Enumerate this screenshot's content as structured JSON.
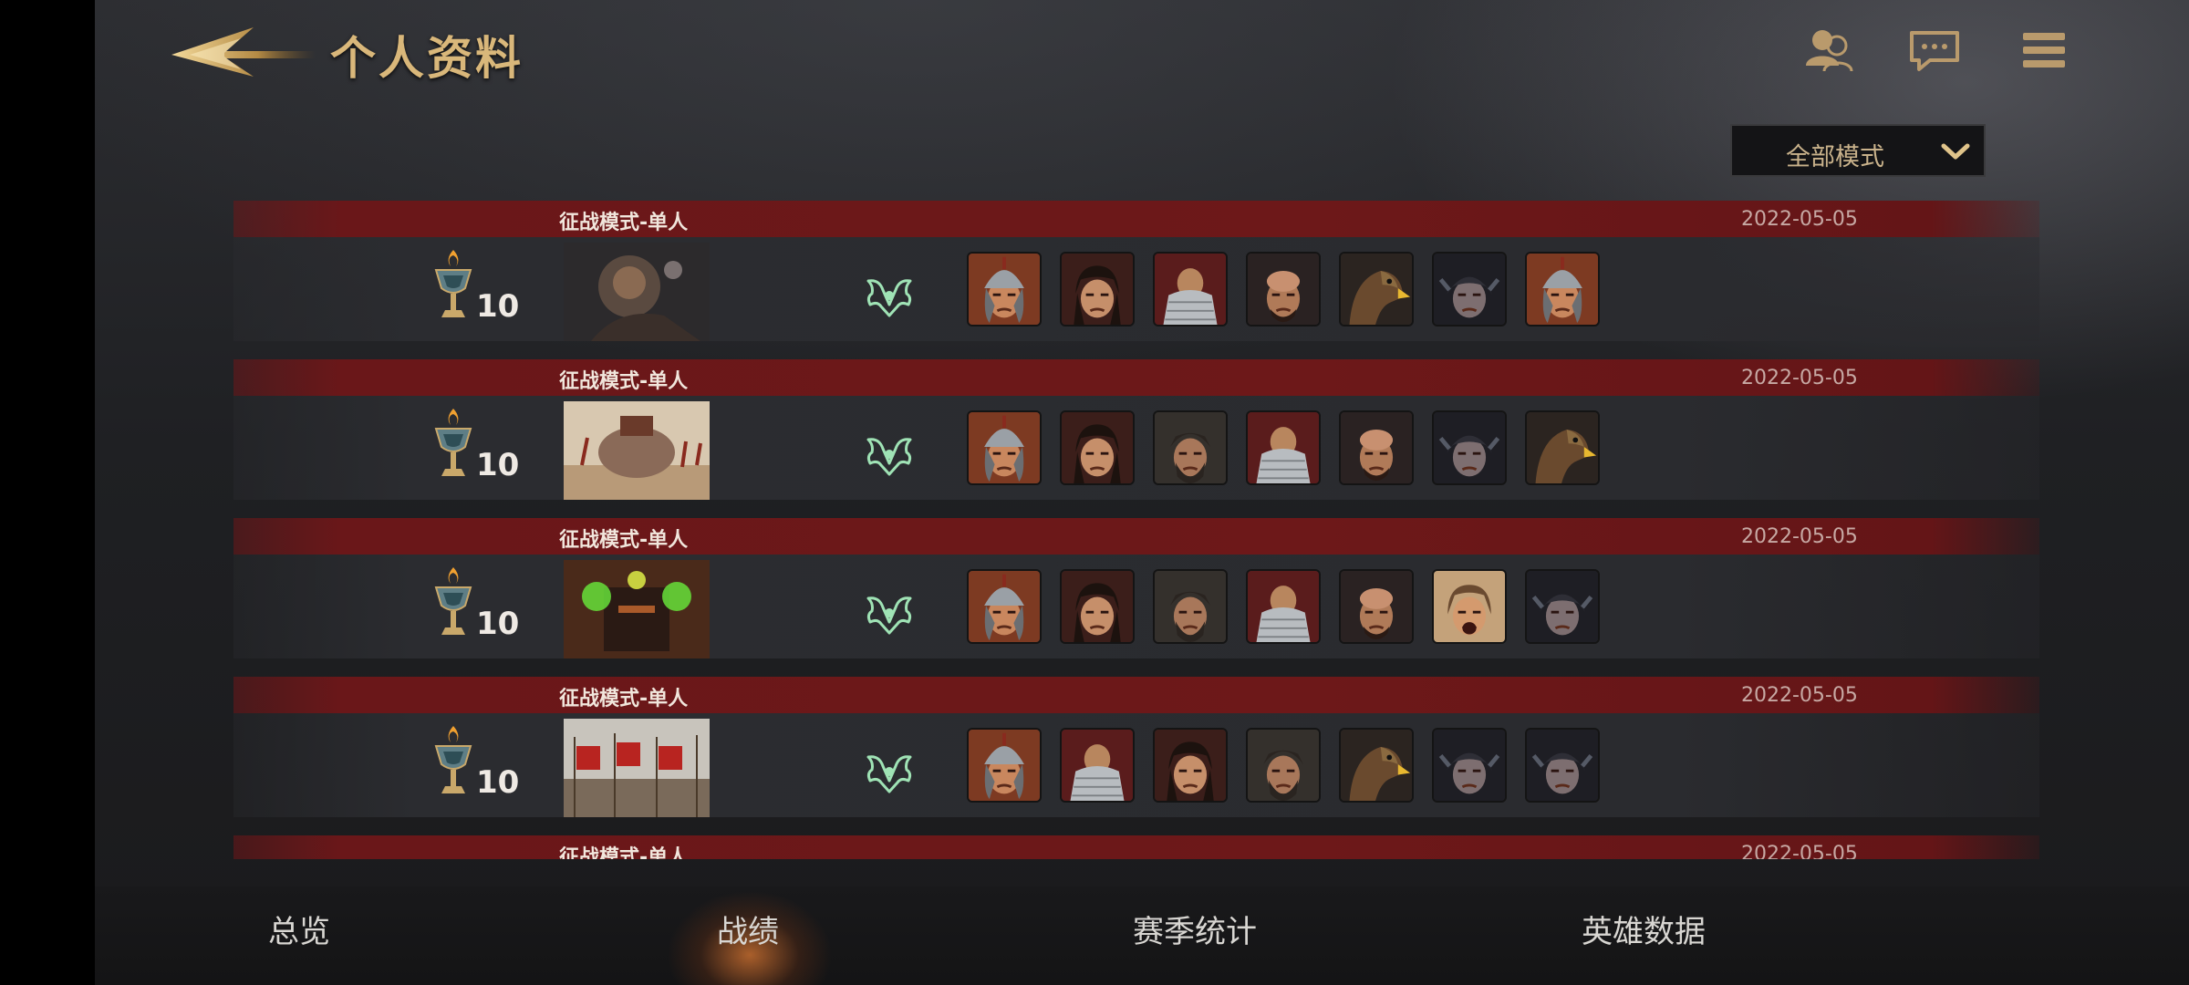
{
  "header": {
    "title": "个人资料"
  },
  "filter": {
    "selected": "全部模式"
  },
  "records": [
    {
      "mode": "征战模式-单人",
      "date": "2022-05-05",
      "score": "10",
      "map": "beast-warrior",
      "heroes": [
        "helmet-warrior",
        "dark-hair",
        "armored-bald",
        "bald-warrior",
        "eagle",
        "dark-helmet",
        "helmet-warrior"
      ]
    },
    {
      "mode": "征战模式-单人",
      "date": "2022-05-05",
      "score": "10",
      "map": "elephant-battle",
      "heroes": [
        "helmet-warrior",
        "dark-hair",
        "bearded",
        "armored-bald",
        "bald-warrior",
        "dark-helmet",
        "eagle"
      ]
    },
    {
      "mode": "征战模式-单人",
      "date": "2022-05-05",
      "score": "10",
      "map": "green-fire-machine",
      "heroes": [
        "helmet-warrior",
        "dark-hair",
        "bearded",
        "armored-bald",
        "bald-warrior",
        "screaming",
        "dark-helmet"
      ]
    },
    {
      "mode": "征战模式-单人",
      "date": "2022-05-05",
      "score": "10",
      "map": "army-banners",
      "heroes": [
        "helmet-warrior",
        "armored-bald",
        "dark-hair",
        "bearded",
        "eagle",
        "dark-helmet",
        "dark-helmet"
      ]
    },
    {
      "mode": "征战模式-单人",
      "date": "2022-05-05",
      "score": "",
      "map": "",
      "heroes": []
    }
  ],
  "nav": {
    "overview": "总览",
    "records": "战绩",
    "season": "赛季统计",
    "heroes": "英雄数据"
  },
  "colors": {
    "accent_gold": "#d9b77a",
    "row_red": "#6d1819",
    "emblem_green": "#9fe3b5"
  }
}
